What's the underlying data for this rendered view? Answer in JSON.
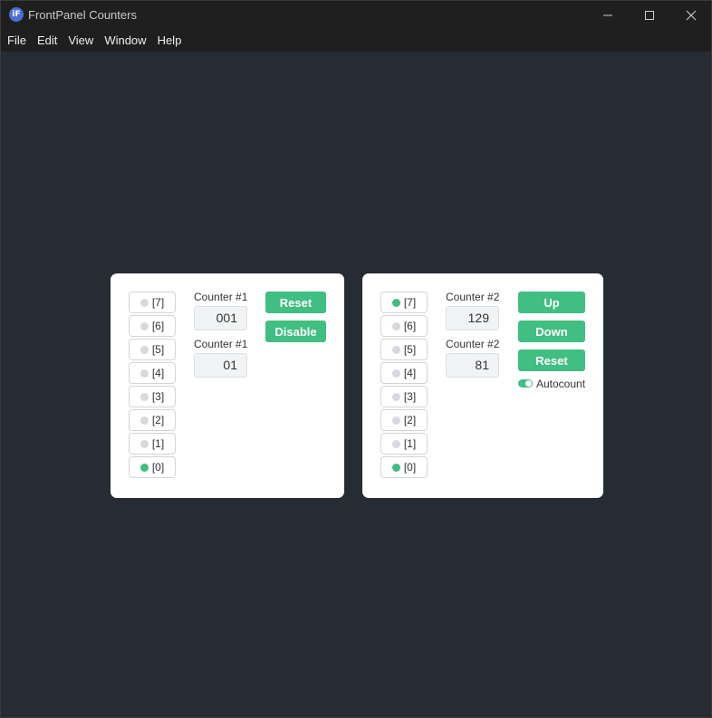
{
  "window": {
    "title": "FrontPanel Counters",
    "icon_name": "frontpanel-app-icon",
    "icon_glyph": "iF"
  },
  "menu": [
    "File",
    "Edit",
    "View",
    "Window",
    "Help"
  ],
  "colors": {
    "accent": "#41be82",
    "led_on": "#3fbc7e",
    "led_off": "#d6d9de",
    "background": "#272b34"
  },
  "panel1": {
    "leds": [
      {
        "label": "[7]",
        "on": false
      },
      {
        "label": "[6]",
        "on": false
      },
      {
        "label": "[5]",
        "on": false
      },
      {
        "label": "[4]",
        "on": false
      },
      {
        "label": "[3]",
        "on": false
      },
      {
        "label": "[2]",
        "on": false
      },
      {
        "label": "[1]",
        "on": false
      },
      {
        "label": "[0]",
        "on": true
      }
    ],
    "counter_a_label": "Counter #1",
    "counter_a_value": "001",
    "counter_b_label": "Counter #1",
    "counter_b_value": "01",
    "reset_label": "Reset",
    "disable_label": "Disable"
  },
  "panel2": {
    "leds": [
      {
        "label": "[7]",
        "on": true
      },
      {
        "label": "[6]",
        "on": false
      },
      {
        "label": "[5]",
        "on": false
      },
      {
        "label": "[4]",
        "on": false
      },
      {
        "label": "[3]",
        "on": false
      },
      {
        "label": "[2]",
        "on": false
      },
      {
        "label": "[1]",
        "on": false
      },
      {
        "label": "[0]",
        "on": true
      }
    ],
    "counter_a_label": "Counter #2",
    "counter_a_value": "129",
    "counter_b_label": "Counter #2",
    "counter_b_value": "81",
    "up_label": "Up",
    "down_label": "Down",
    "reset_label": "Reset",
    "autocount_label": "Autocount",
    "autocount_on": true
  }
}
